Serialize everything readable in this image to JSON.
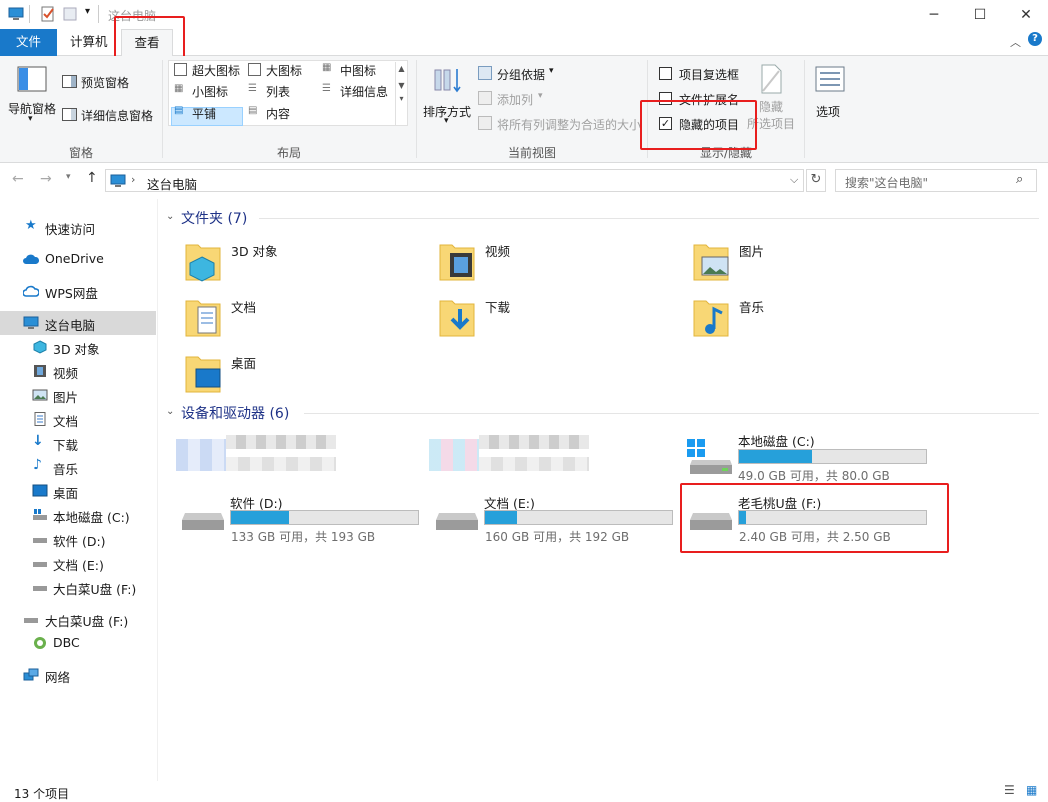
{
  "window": {
    "title": "这台电脑",
    "minimize": "─",
    "maximize": "☐",
    "close": "✕"
  },
  "tabs": {
    "file": "文件",
    "computer": "计算机",
    "view": "查看"
  },
  "ribbon": {
    "panes": {
      "nav_pane": "导航窗格",
      "preview_pane": "预览窗格",
      "details_pane": "详细信息窗格",
      "group": "窗格"
    },
    "layout": {
      "extra_large": "超大图标",
      "large": "大图标",
      "medium": "中图标",
      "small": "小图标",
      "list": "列表",
      "details": "详细信息",
      "tiles": "平铺",
      "content": "内容",
      "group": "布局"
    },
    "current_view": {
      "sort_by": "排序方式",
      "group_by": "分组依据",
      "add_columns": "添加列",
      "fit_columns": "将所有列调整为合适的大小",
      "group": "当前视图"
    },
    "show_hide": {
      "item_checkboxes": "项目复选框",
      "file_extensions": "文件扩展名",
      "hidden_items": "隐藏的项目",
      "hide_selected_1": "隐藏",
      "hide_selected_2": "所选项目",
      "group": "显示/隐藏"
    },
    "options": "选项"
  },
  "address": {
    "path": "这台电脑",
    "search_placeholder": "搜索\"这台电脑\""
  },
  "nav": {
    "quick_access": "快速访问",
    "onedrive": "OneDrive",
    "wps": "WPS网盘",
    "this_pc": "这台电脑",
    "objects3d": "3D 对象",
    "videos": "视频",
    "pictures": "图片",
    "documents": "文档",
    "downloads": "下载",
    "music": "音乐",
    "desktop": "桌面",
    "local_c": "本地磁盘 (C:)",
    "soft_d": "软件 (D:)",
    "doc_e": "文档 (E:)",
    "usb_f_sub": "大白菜U盘 (F:)",
    "usb_f": "大白菜U盘 (F:)",
    "dbc": "DBC",
    "network": "网络"
  },
  "folders": {
    "header": "文件夹 (7)",
    "items": [
      "3D 对象",
      "视频",
      "图片",
      "文档",
      "下载",
      "音乐",
      "桌面"
    ]
  },
  "drives": {
    "header": "设备和驱动器 (6)",
    "items": [
      {
        "name": "本地磁盘 (C:)",
        "free": "49.0 GB 可用，共 80.0 GB",
        "used_fraction": 0.39
      },
      {
        "name": "软件 (D:)",
        "free": "133 GB 可用，共 193 GB",
        "used_fraction": 0.31
      },
      {
        "name": "文档 (E:)",
        "free": "160 GB 可用，共 192 GB",
        "used_fraction": 0.17
      },
      {
        "name": "老毛桃U盘 (F:)",
        "free": "2.40 GB 可用，共 2.50 GB",
        "used_fraction": 0.04
      }
    ]
  },
  "status": {
    "count": "13 个项目"
  },
  "colors": {
    "accent": "#1979ca",
    "bar_fill": "#26a0da",
    "highlight": "#e81e1e",
    "section_head": "#1e3287"
  }
}
